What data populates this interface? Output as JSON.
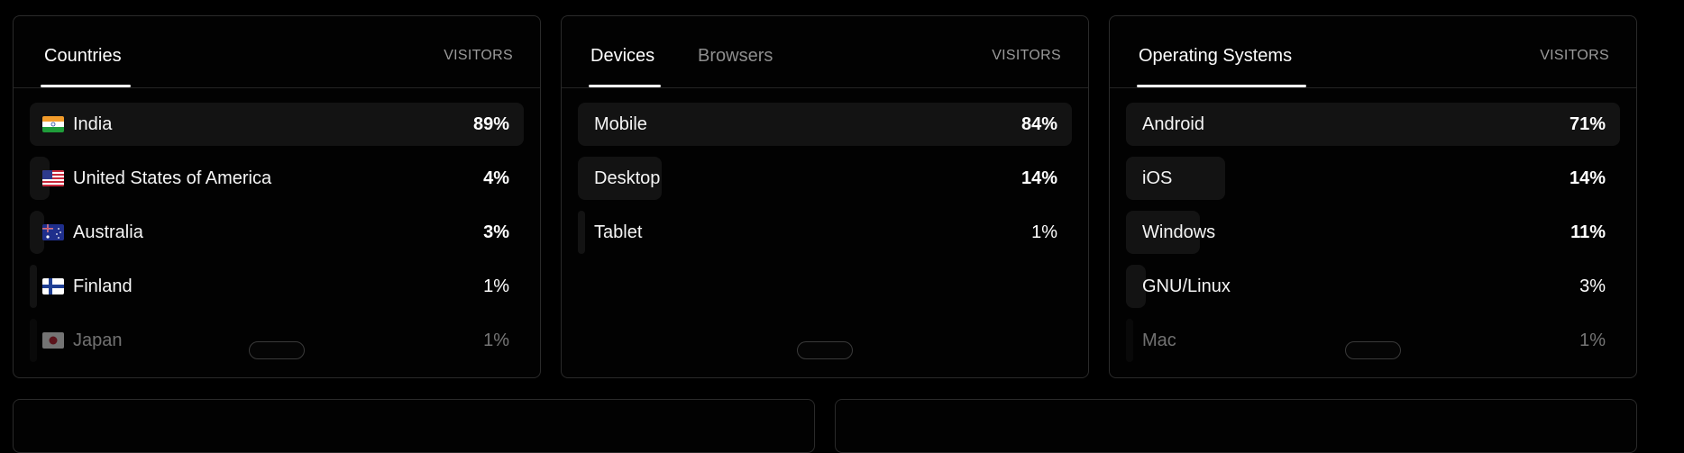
{
  "countries_panel": {
    "tab_label": "Countries",
    "visitors_label": "VISITORS",
    "rows": [
      {
        "label": "India",
        "value": "89%",
        "flag": "india-flag-icon",
        "fraction": 1.0
      },
      {
        "label": "United States of America",
        "value": "4%",
        "flag": "usa-flag-icon",
        "fraction": 0.04
      },
      {
        "label": "Australia",
        "value": "3%",
        "flag": "australia-flag-icon",
        "fraction": 0.03
      },
      {
        "label": "Finland",
        "value": "1%",
        "flag": "finland-flag-icon",
        "fraction": 0.01
      },
      {
        "label": "Japan",
        "value": "1%",
        "flag": "japan-flag-icon",
        "fraction": 0.01
      }
    ]
  },
  "devices_panel": {
    "tab_devices": "Devices",
    "tab_browsers": "Browsers",
    "visitors_label": "VISITORS",
    "rows": [
      {
        "label": "Mobile",
        "value": "84%",
        "fraction": 1.0
      },
      {
        "label": "Desktop",
        "value": "14%",
        "fraction": 0.17
      },
      {
        "label": "Tablet",
        "value": "1%",
        "fraction": 0.01
      }
    ]
  },
  "os_panel": {
    "tab_label": "Operating Systems",
    "visitors_label": "VISITORS",
    "rows": [
      {
        "label": "Android",
        "value": "71%",
        "fraction": 1.0
      },
      {
        "label": "iOS",
        "value": "14%",
        "fraction": 0.2
      },
      {
        "label": "Windows",
        "value": "11%",
        "fraction": 0.15
      },
      {
        "label": "GNU/Linux",
        "value": "3%",
        "fraction": 0.04
      },
      {
        "label": "Mac",
        "value": "1%",
        "fraction": 0.01
      }
    ]
  }
}
